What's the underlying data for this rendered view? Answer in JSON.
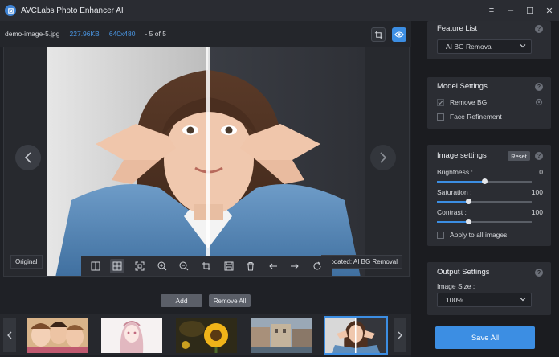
{
  "app": {
    "title": "AVCLabs Photo Enhancer AI"
  },
  "window_controls": {
    "menu": "≡",
    "minimize": "–",
    "maximize": "☐",
    "close": "✕"
  },
  "info": {
    "filename": "demo-image-5.jpg",
    "filesize": "227.96KB",
    "dimensions": "640x480",
    "count": "- 5 of 5"
  },
  "canvas": {
    "label_original": "Original",
    "label_updated": "Updated: AI BG Removal"
  },
  "bottom": {
    "add_label": "Add",
    "remove_all_label": "Remove All"
  },
  "thumbnails": [
    {
      "name": "thumbnail-group-selfie"
    },
    {
      "name": "thumbnail-anime-girl"
    },
    {
      "name": "thumbnail-sunflower"
    },
    {
      "name": "thumbnail-city-street"
    },
    {
      "name": "thumbnail-woman-peace"
    }
  ],
  "panel": {
    "feature_list": {
      "title": "Feature List",
      "selected": "AI BG Removal"
    },
    "model_settings": {
      "title": "Model Settings",
      "remove_bg": "Remove BG",
      "remove_bg_checked": true,
      "face_refinement": "Face Refinement",
      "face_refinement_checked": false
    },
    "image_settings": {
      "title": "Image settings",
      "reset_label": "Reset",
      "brightness_label": "Brightness :",
      "brightness_value": "0",
      "brightness_fraction": 0.5,
      "saturation_label": "Saturation :",
      "saturation_value": "100",
      "saturation_fraction": 0.33,
      "contrast_label": "Contrast :",
      "contrast_value": "100",
      "contrast_fraction": 0.33,
      "apply_all": "Apply to all images"
    },
    "output_settings": {
      "title": "Output Settings",
      "image_size_label": "Image Size :",
      "image_size": "100%"
    },
    "save_all_label": "Save All"
  },
  "colors": {
    "accent": "#3c8ee3",
    "panel_bg": "#2b2d33",
    "app_bg": "#1f2126"
  }
}
